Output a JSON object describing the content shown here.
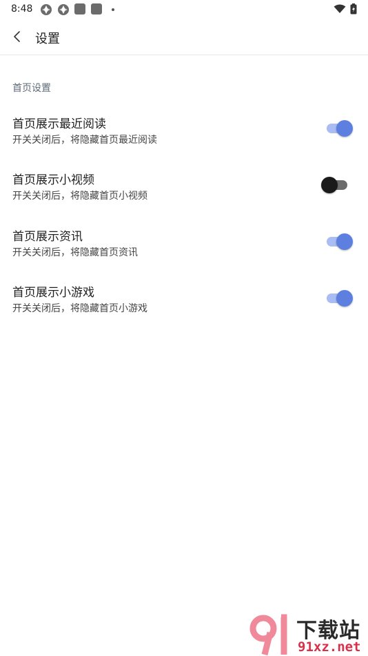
{
  "status_bar": {
    "time": "8:48"
  },
  "header": {
    "title": "设置"
  },
  "section": {
    "title": "首页设置"
  },
  "settings": [
    {
      "title": "首页展示最近阅读",
      "desc": "开关关闭后，将隐藏首页最近阅读",
      "enabled": true
    },
    {
      "title": "首页展示小视频",
      "desc": "开关关闭后，将隐藏首页小视频",
      "enabled": false
    },
    {
      "title": "首页展示资讯",
      "desc": "开关关闭后，将隐藏首页资讯",
      "enabled": true
    },
    {
      "title": "首页展示小游戏",
      "desc": "开关关闭后，将隐藏首页小游戏",
      "enabled": true
    }
  ],
  "watermark": {
    "text": "下载站",
    "url": "91xz.net"
  },
  "colors": {
    "accent": "#5c7fe0",
    "accent_track": "#a9bcf3",
    "off_thumb": "#1a1a1a",
    "watermark_red": "#d9304a"
  }
}
